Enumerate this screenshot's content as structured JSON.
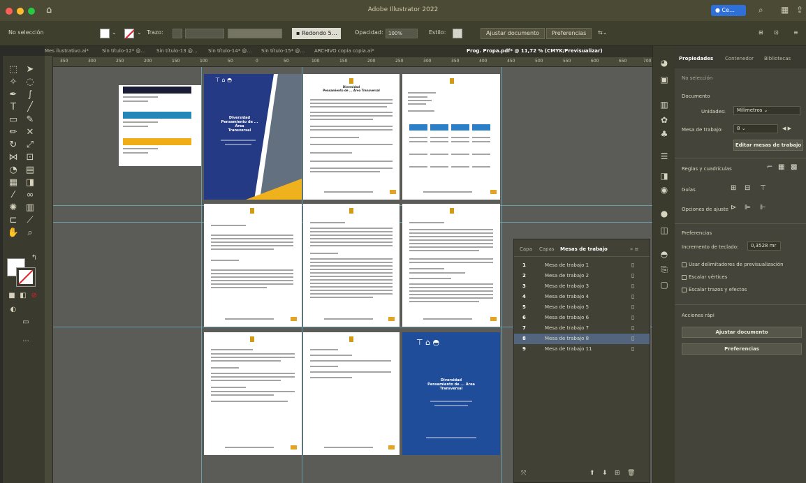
{
  "app": {
    "title": "Adobe Illustrator 2022",
    "user_label": "Ce…",
    "search_icon": "search-icon",
    "home_icon": "home-icon",
    "colors": {
      "titlebar": "#4a4a35",
      "accent_blue": "#2f6fd8",
      "traffic_red": "#ff5f57",
      "traffic_yellow": "#febc2e",
      "traffic_green": "#28c840"
    }
  },
  "controlbar": {
    "selection_label": "No selección",
    "stroke_label": "Trazo:",
    "brush_label": "Redondo 5…",
    "opacity_label": "Opacidad:",
    "opacity_value": "100%",
    "style_label": "Estilo:",
    "adjust_button": "Ajustar documento",
    "prefs_button": "Preferencias"
  },
  "tabs": [
    "Mes ilustrativo.ai*",
    "Sin título-12* @…",
    "Sin título-13 @…",
    "Sin título-14* @…",
    "Sin título-15* @…",
    "ARCHIVO copia copia.ai*",
    "Prog. Propa.pdf* @ 11,72 % (CMYK/Previsualizar)"
  ],
  "ruler_ticks": [
    "350",
    "300",
    "250",
    "200",
    "150",
    "100",
    "50",
    "0",
    "50",
    "100",
    "150",
    "200",
    "250",
    "300",
    "350",
    "400",
    "450",
    "500",
    "550",
    "600",
    "650",
    "700"
  ],
  "properties": {
    "tabs": [
      "Propiedades",
      "Contenedor",
      "Bibliotecas"
    ],
    "no_selection": "No selección",
    "document_header": "Documento",
    "units_label": "Unidades:",
    "units_value": "Milímetros",
    "artboard_label": "Mesa de trabajo:",
    "artboard_value": "8",
    "edit_artboards_button": "Editar mesas de trabajo",
    "rulers_label": "Reglas y cuadrículas",
    "guides_label": "Guías",
    "snap_label": "Opciones de ajuste",
    "preferences_header": "Preferencias",
    "keyboard_increment_label": "Incremento de teclado:",
    "keyboard_increment_value": "0,3528 mr",
    "checkboxes": [
      "Usar delimitadores de previsualización",
      "Escalar vértices",
      "Escalar trazos y efectos"
    ],
    "quick_actions_header": "Acciones rápi",
    "adjust_button": "Ajustar documento",
    "prefs_button": "Preferencias"
  },
  "artboards_panel": {
    "tabs": [
      "Capa",
      "Capas",
      "Mesas de trabajo"
    ],
    "rows": [
      {
        "num": "1",
        "name": "Mesa de trabajo 1"
      },
      {
        "num": "2",
        "name": "Mesa de trabajo 2"
      },
      {
        "num": "3",
        "name": "Mesa de trabajo 3"
      },
      {
        "num": "4",
        "name": "Mesa de trabajo 4"
      },
      {
        "num": "5",
        "name": "Mesa de trabajo 5"
      },
      {
        "num": "6",
        "name": "Mesa de trabajo 6"
      },
      {
        "num": "7",
        "name": "Mesa de trabajo 7"
      },
      {
        "num": "8",
        "name": "Mesa de trabajo 8"
      },
      {
        "num": "9",
        "name": "Mesa de trabajo 11"
      }
    ],
    "selected_index": 7
  },
  "cover": {
    "title": "Diversidad\nPensamiento de ... Área\nTransversal",
    "back_title": "Diversidad\nPensamiento de ... Área\nTransversal"
  },
  "page2": {
    "heading": "Diversidad\nPensamiento de ... Área Transversal"
  }
}
